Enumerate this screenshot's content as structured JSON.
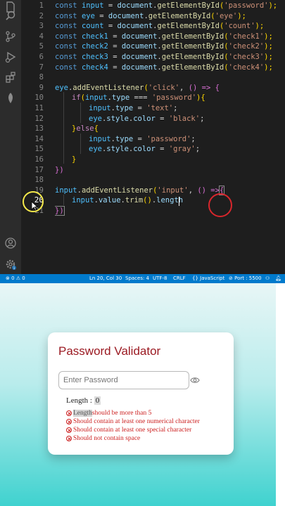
{
  "editor": {
    "line_numbers": [
      "1",
      "2",
      "3",
      "4",
      "5",
      "6",
      "7",
      "8",
      "9",
      "10",
      "11",
      "12",
      "13",
      "14",
      "15",
      "16",
      "17",
      "18",
      "19",
      "20",
      "21"
    ],
    "current_line": "20",
    "code": {
      "l1": {
        "kw": "const",
        "v": "input",
        "eq": " = ",
        "obj": "document",
        "dot": ".",
        "fn": "getElementById",
        "open": "(",
        "str": "'password'",
        "close": ");"
      },
      "l2": {
        "kw": "const",
        "v": "eye",
        "eq": " = ",
        "obj": "document",
        "dot": ".",
        "fn": "getElementById",
        "open": "(",
        "str": "'eye'",
        "close": ");"
      },
      "l3": {
        "kw": "const",
        "v": "count",
        "eq": " = ",
        "obj": "document",
        "dot": ".",
        "fn": "getElementById",
        "open": "(",
        "str": "'count'",
        "close": ");"
      },
      "l4": {
        "kw": "const",
        "v": "check1",
        "eq": " = ",
        "obj": "document",
        "dot": ".",
        "fn": "getElementById",
        "open": "(",
        "str": "'check1'",
        "close": ");"
      },
      "l5": {
        "kw": "const",
        "v": "check2",
        "eq": " = ",
        "obj": "document",
        "dot": ".",
        "fn": "getElementById",
        "open": "(",
        "str": "'check2'",
        "close": ");"
      },
      "l6": {
        "kw": "const",
        "v": "check3",
        "eq": " = ",
        "obj": "document",
        "dot": ".",
        "fn": "getElementById",
        "open": "(",
        "str": "'check3'",
        "close": ");"
      },
      "l7": {
        "kw": "const",
        "v": "check4",
        "eq": " = ",
        "obj": "document",
        "dot": ".",
        "fn": "getElementById",
        "open": "(",
        "str": "'check4'",
        "close": ");"
      },
      "l9": {
        "v": "eye",
        "dot": ".",
        "fn": "addEventListener",
        "open": "(",
        "str": "'click'",
        "mid": ", ",
        "arrow": "() => ",
        "brace": "{"
      },
      "l10": {
        "kw": "if",
        "open": "(",
        "v": "input",
        "dot": ".",
        "prop": "type",
        "eq": " === ",
        "str": "'password'",
        "close": "){"
      },
      "l11": {
        "v": "input",
        "dot": ".",
        "prop": "type",
        "eq": " = ",
        "str": "'text'",
        "end": ";"
      },
      "l12": {
        "v": "eye",
        "dot": ".",
        "prop": "style",
        "dot2": ".",
        "prop2": "color",
        "eq": " = ",
        "str": "'black'",
        "end": ";"
      },
      "l13": {
        "close": "}",
        "kw": "else",
        "brace": "{"
      },
      "l14": {
        "v": "input",
        "dot": ".",
        "prop": "type",
        "eq": " = ",
        "str": "'password'",
        "end": ";"
      },
      "l15": {
        "v": "eye",
        "dot": ".",
        "prop": "style",
        "dot2": ".",
        "prop2": "color",
        "eq": " = ",
        "str": "'gray'",
        "end": ";"
      },
      "l16": {
        "close": "}"
      },
      "l17": {
        "close": "})"
      },
      "l19": {
        "v": "input",
        "dot": ".",
        "fn": "addEventListener",
        "open": "(",
        "str": "'input'",
        "mid": ", ",
        "arrow": "() =>",
        "brace": "{"
      },
      "l20": {
        "v": "input",
        "dot": ".",
        "prop": "value",
        "dot2": ".",
        "fn": "trim",
        "call": "()",
        "dot3": ".",
        "prop2": "length"
      },
      "l21": {
        "close": "})"
      }
    }
  },
  "activity_icons": [
    "files-icon",
    "search-icon",
    "source-control-icon",
    "run-debug-icon",
    "extensions-icon",
    "mongodb-leaf-icon",
    "account-icon",
    "settings-gear-icon"
  ],
  "statusbar": {
    "errors": "0",
    "warnings": "0",
    "position": "Ln 20, Col 30",
    "spaces": "Spaces: 4",
    "encoding": "UTF-8",
    "eol": "CRLF",
    "language": "JavaScript",
    "port": "Port : 5500",
    "notification_count": "1"
  },
  "app": {
    "title": "Password Validator",
    "input_placeholder": "Enter Password",
    "length_label": "Length : ",
    "length_value": "0",
    "rules": {
      "r1_highlight": "Length",
      "r1_rest": " should be more than 5",
      "r2": "Should contain at least one numerical character",
      "r3": "Should contain at least one special character",
      "r4": "Should not contain space"
    }
  },
  "colors": {
    "status_bar": "#007acc",
    "title_red": "#9b1a22",
    "rule_red": "#cc1f1f",
    "teal": "#3fd2cf"
  }
}
